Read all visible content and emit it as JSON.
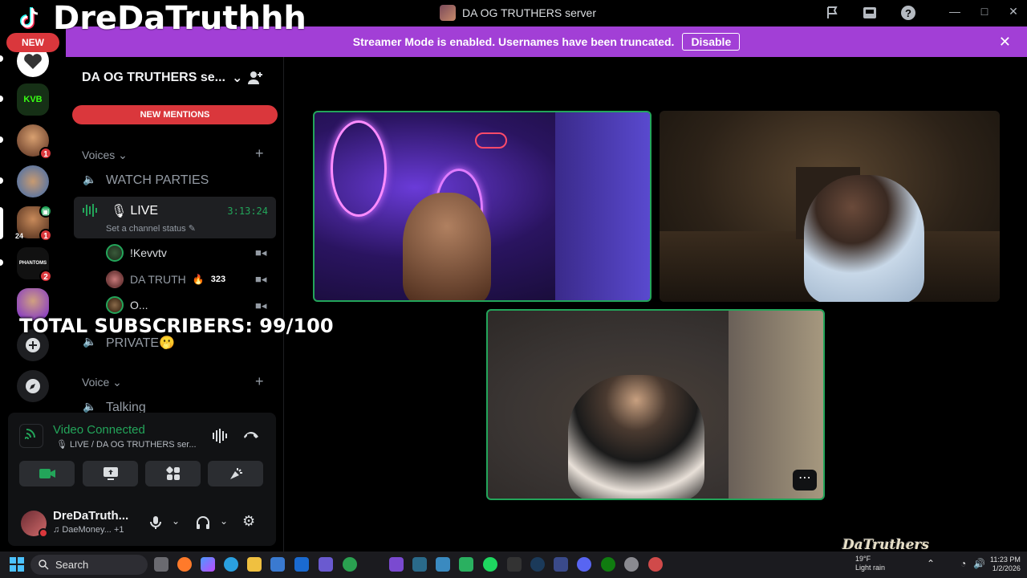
{
  "window": {
    "server_title": "DA OG TRUTHERS server",
    "minimize": "—",
    "maximize": "□",
    "close": "✕"
  },
  "overlay": {
    "channel_name": "DreDaTruthhh",
    "new_badge": "NEW",
    "subscribers": "TOTAL SUBSCRIBERS: 99/100",
    "watermark": "DaTruthers"
  },
  "banner": {
    "message": "Streamer Mode is enabled. Usernames have been truncated.",
    "button": "Disable"
  },
  "rail": {
    "items": [
      {
        "name": "server-heart",
        "color": "#ffffff",
        "badge": ""
      },
      {
        "name": "server-kvb",
        "label": "KVB",
        "color": "#1a3a1a",
        "badge": ""
      },
      {
        "name": "server-avatar-1",
        "color": "#8a5a40",
        "badge": "1"
      },
      {
        "name": "server-avatar-2",
        "color": "#5a8ac8",
        "badge": ""
      },
      {
        "name": "server-avatar-3",
        "color": "#7a5a3a",
        "badge": "1",
        "sub": "24"
      },
      {
        "name": "server-phantoms",
        "label": "PHANTOMS",
        "color": "#222222",
        "badge": "2"
      },
      {
        "name": "server-avatar-4",
        "color": "#8a3ad0",
        "badge": ""
      }
    ]
  },
  "sidebar": {
    "server_name": "DA OG TRUTHERS se...",
    "new_mentions": "NEW MENTIONS",
    "categories": {
      "voices": "Voices",
      "voice": "Voice"
    },
    "channels": {
      "watch_parties": "WATCH PARTIES",
      "live": "LIVE",
      "live_timer": "3:13:24",
      "live_status": "Set a channel status",
      "private": "PRIVATE🫢",
      "talking": "Talking"
    },
    "members": [
      {
        "name": "!Kevvtv",
        "badge": ""
      },
      {
        "name": "DA TRUTH",
        "badge": "323"
      },
      {
        "name": "O...",
        "badge": ""
      }
    ]
  },
  "voice_panel": {
    "status": "Video Connected",
    "location": "LIVE / DA OG TRUTHERS ser...",
    "buttons": [
      "camera",
      "screen-share",
      "activities",
      "soundboard"
    ]
  },
  "user": {
    "name": "DreDaTruth...",
    "activity": "DaeMoney...",
    "activity_extra": "+1"
  },
  "taskbar": {
    "search": "Search",
    "weather_temp": "19°F",
    "weather_desc": "Light rain",
    "time": "11:23 PM",
    "date": "1/2/2026"
  },
  "colors": {
    "accent_green": "#23a55a",
    "banner_purple": "#a23fd6",
    "mentions_red": "#da373c"
  }
}
